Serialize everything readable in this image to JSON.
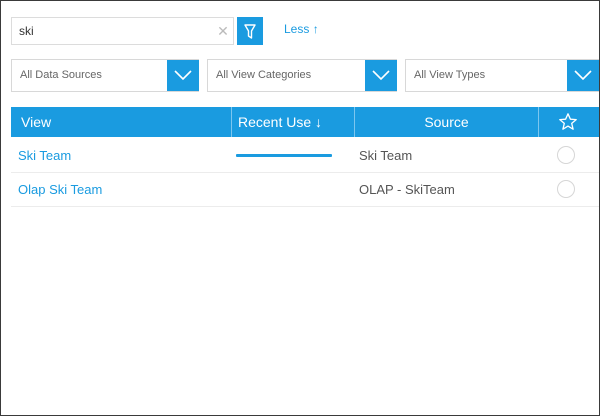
{
  "search": {
    "value": "ski",
    "clear_icon": "close-icon"
  },
  "filter_button": {
    "icon": "filter-icon"
  },
  "less_link": {
    "label": "Less",
    "arrow": "↑"
  },
  "dropdowns": [
    {
      "selected": "All Data Sources"
    },
    {
      "selected": "All View Categories"
    },
    {
      "selected": "All View Types"
    }
  ],
  "grid": {
    "headers": {
      "view": "View",
      "recent_use": "Recent Use",
      "sort_arrow": "↓",
      "source": "Source",
      "favourite_icon": "star-outline-icon"
    },
    "rows": [
      {
        "view": "Ski Team",
        "recent_use_fraction": 1.0,
        "source": "Ski Team"
      },
      {
        "view": "Olap Ski Team",
        "recent_use_fraction": 0,
        "source": "OLAP - SkiTeam"
      }
    ]
  },
  "colors": {
    "accent": "#1a9be0",
    "border": "#3a3a3a"
  }
}
